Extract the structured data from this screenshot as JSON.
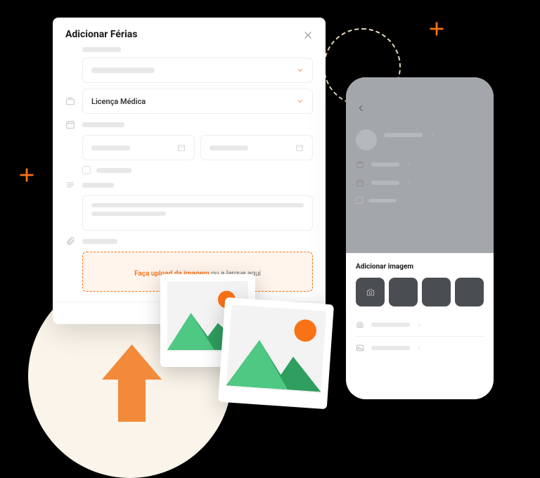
{
  "modal": {
    "title": "Adicionar Férias",
    "typeSelect": {
      "value": "Licença Médica"
    },
    "upload": {
      "linkText": "Faça upload da imagem",
      "suffixText": " ou a largue aqui"
    }
  },
  "phone": {
    "bottomSheet": {
      "title": "Adicionar imagem"
    }
  },
  "colors": {
    "accent": "#f97316",
    "uploadBg": "#fff5ed",
    "phoneGrey": "#a3a6ab",
    "thumbDark": "#4a4d52"
  }
}
